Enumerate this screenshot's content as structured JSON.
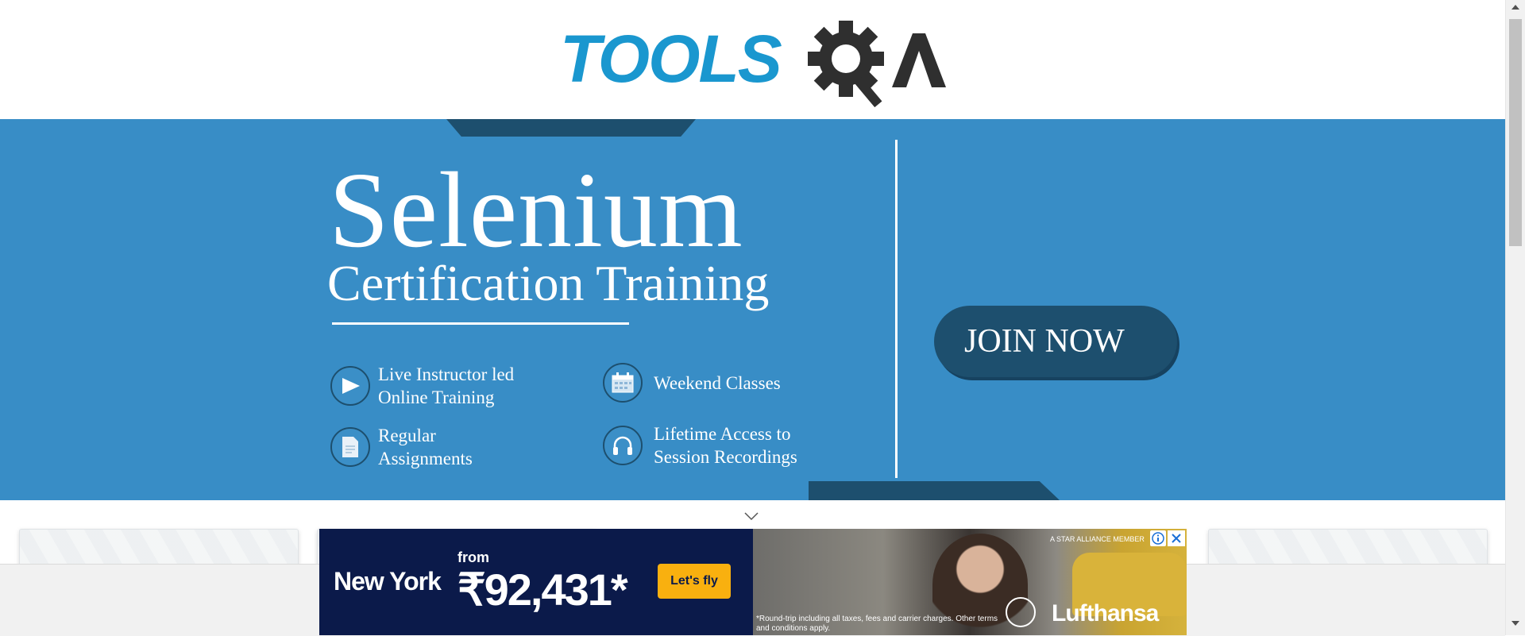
{
  "header": {
    "logo_text": "TOOLS",
    "logo_suffix": "QA"
  },
  "banner": {
    "title": "Selenium",
    "subtitle": "Certification Training",
    "features": [
      {
        "line1": "Live Instructor led",
        "line2": "Online Training",
        "icon": "play-icon"
      },
      {
        "line1": "Weekend Classes",
        "line2": "",
        "icon": "calendar-icon"
      },
      {
        "line1": "Regular",
        "line2": "Assignments",
        "icon": "document-icon"
      },
      {
        "line1": "Lifetime Access to",
        "line2": "Session Recordings",
        "icon": "headphones-icon"
      }
    ],
    "cta": "JOIN NOW"
  },
  "ad": {
    "destination": "New York",
    "from_label": "from",
    "price": "₹92,431*",
    "cta": "Let's fly",
    "alliance": "A STAR ALLIANCE MEMBER",
    "fine_print": "*Round-trip including all taxes, fees and carrier charges. Other terms and conditions apply.",
    "brand": "Lufthansa"
  },
  "colors": {
    "brand_blue": "#1a97cf",
    "banner": "#388dc6",
    "navy": "#1d4f6e",
    "ad_yellow": "#f9b00f"
  }
}
